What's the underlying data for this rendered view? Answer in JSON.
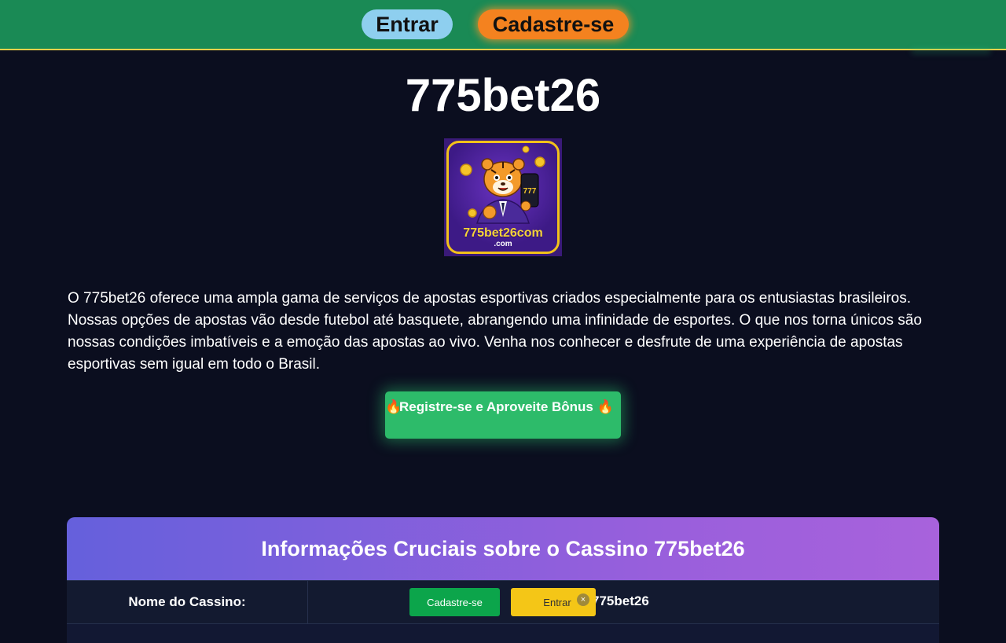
{
  "header": {
    "login_label": "Entrar",
    "signup_label": "Cadastre-se",
    "colors": {
      "bar": "#1a8a55",
      "login": "#8ecfef",
      "signup": "#f4821f"
    }
  },
  "page": {
    "title": "775bet26"
  },
  "logo": {
    "text": "775bet26com",
    "subtext": ".com",
    "phone_text": "777"
  },
  "intro": {
    "text": "O 775bet26 oferece uma ampla gama de serviços de apostas esportivas criados especialmente para os entusiastas brasileiros. Nossas opções de apostas vão desde futebol até basquete, abrangendo uma infinidade de esportes. O que nos torna únicos são nossas condições imbatíveis e a emoção das apostas ao vivo. Venha nos conhecer e desfrute de uma experiência de apostas esportivas sem igual em todo o Brasil."
  },
  "cta": {
    "label": "Registre-se e Aproveite Bônus",
    "icon": "fire-icon",
    "emoji": "🔥",
    "color": "#2dbb6a"
  },
  "info_section": {
    "title": "Informações Cruciais sobre o Cassino 775bet26",
    "rows": [
      {
        "label": "Nome do Cassino:",
        "value": "775bet26"
      }
    ]
  },
  "floating_bar": {
    "signup_label": "Cadastre-se",
    "login_label": "Entrar",
    "close_symbol": "×"
  }
}
